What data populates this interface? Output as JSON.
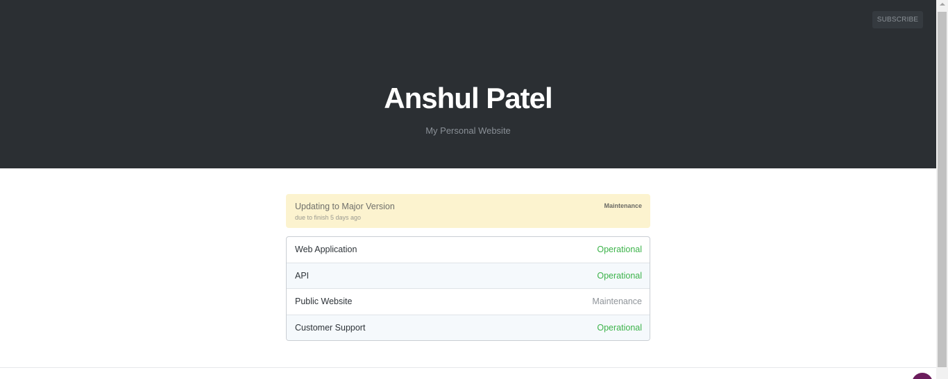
{
  "header": {
    "subscribe_label": "SUBSCRIBE",
    "title": "Anshul Patel",
    "subtitle": "My Personal Website",
    "background": "#2b2f33"
  },
  "incident": {
    "title": "Updating to Major Version",
    "subtitle": "due to finish 5 days ago",
    "badge": "Maintenance",
    "background": "#fcf3cf"
  },
  "components": [
    {
      "name": "Web Application",
      "status": "Operational"
    },
    {
      "name": "API",
      "status": "Operational"
    },
    {
      "name": "Public Website",
      "status": "Maintenance"
    },
    {
      "name": "Customer Support",
      "status": "Operational"
    }
  ],
  "colors": {
    "operational": "#3cb34a",
    "maintenance": "#8f9499",
    "chat_bubble": "#6b1d5c"
  },
  "icons": {
    "chat": "chat-bubble-icon",
    "scroll_up": "chevron-up-icon"
  }
}
